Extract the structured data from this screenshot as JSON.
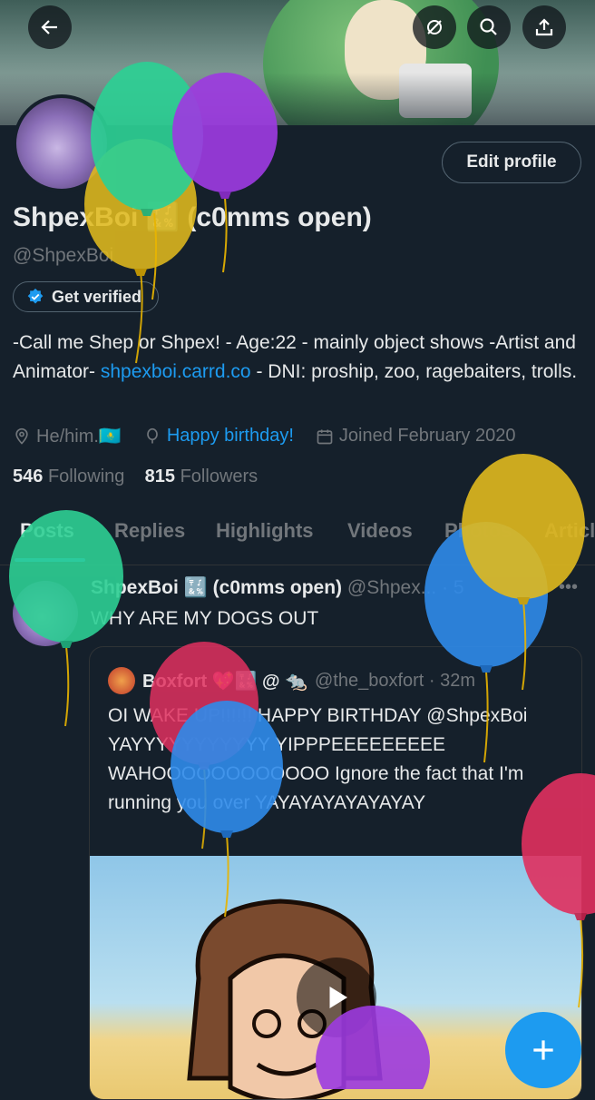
{
  "header": {
    "back_icon": "arrow-left-icon",
    "translate_icon": "no-sync-icon",
    "search_icon": "search-icon",
    "share_icon": "share-icon"
  },
  "profile": {
    "name": "ShpexBoi 🔣 (c0mms open)",
    "handle": "@ShpexBoi",
    "edit_label": "Edit profile",
    "verify_label": "Get verified",
    "bio_part1": "-Call me Shep or Shpex! - Age:22 - mainly object shows -Artist and Animator- ",
    "bio_link": "shpexboi.carrd.co",
    "bio_part2": " - DNI: proship, zoo, ragebaiters, trolls.",
    "pronouns": "He/him.🇰🇿",
    "birthday": "Happy birthday!",
    "joined": "Joined February 2020",
    "following_count": "546",
    "following_label": "Following",
    "followers_count": "815",
    "followers_label": "Followers"
  },
  "tabs": [
    "Posts",
    "Replies",
    "Highlights",
    "Videos",
    "Photos",
    "Articles"
  ],
  "post": {
    "name": "ShpexBoi 🔣 (c0mms open)",
    "handle": "@Shpex...",
    "time": "5",
    "text": "WHY ARE MY DOGS OUT",
    "quote": {
      "name": "Boxfort 💖🔣 @ 🐀",
      "handle": "@the_boxfort · 32m",
      "text": "OI WAKE UP!!!!!! HAPPY BIRTHDAY @ShpexBoi YAYYYYYYYYYYY YIPPPEEEEEEEEE WAHOOOOOOOOOOOO Ignore the fact that I'm running you over YAYAYAYAYAYAYAY"
    }
  },
  "colors": {
    "background": "#15202b",
    "accent": "#1d9bf0",
    "muted": "#71767b"
  }
}
